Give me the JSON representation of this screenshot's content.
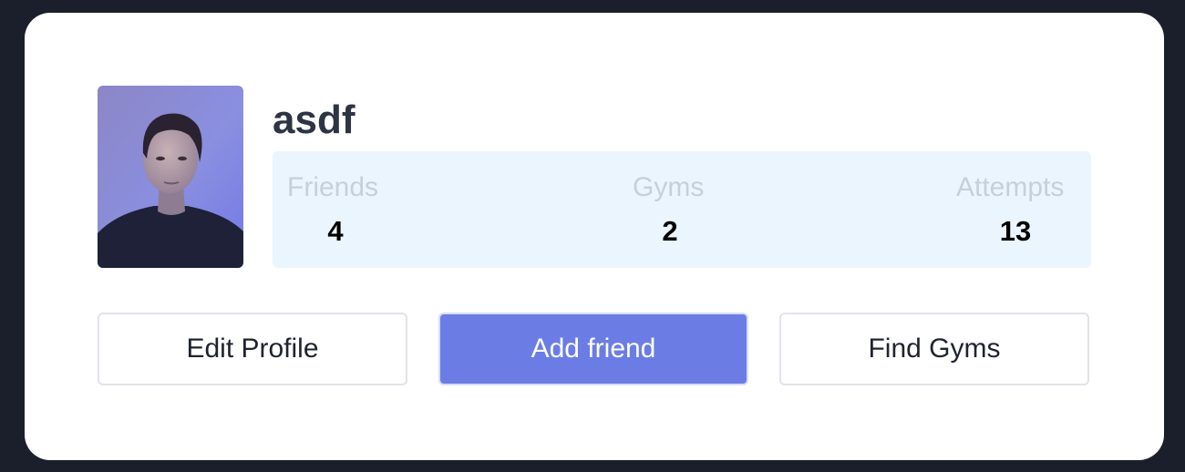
{
  "profile": {
    "username": "asdf",
    "avatar_alt": "profile photo"
  },
  "stats": [
    {
      "label": "Friends",
      "value": "4"
    },
    {
      "label": "Gyms",
      "value": "2"
    },
    {
      "label": "Attempts",
      "value": "13"
    }
  ],
  "actions": {
    "edit_profile": "Edit Profile",
    "add_friend": "Add friend",
    "find_gyms": "Find Gyms"
  },
  "colors": {
    "page_background": "#1b1f2b",
    "card_background": "#ffffff",
    "stats_background": "#ebf5fd",
    "primary_button": "#6b7de5",
    "username_text": "#2d3444",
    "stat_label_text": "#c6d0d9"
  }
}
